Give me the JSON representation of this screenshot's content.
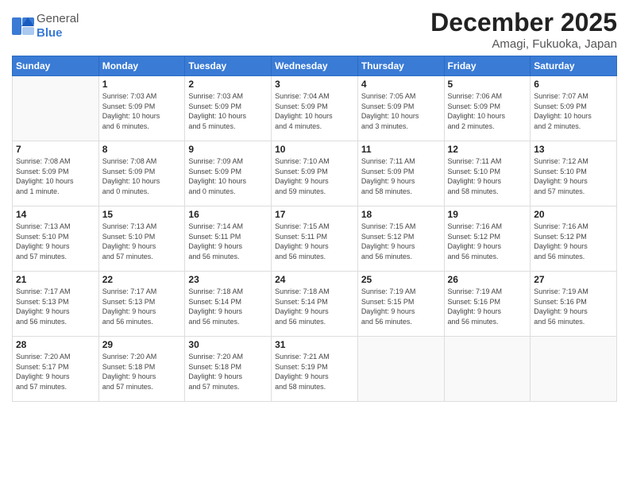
{
  "header": {
    "logo": {
      "general": "General",
      "blue": "Blue"
    },
    "title": "December 2025",
    "location": "Amagi, Fukuoka, Japan"
  },
  "weekdays": [
    "Sunday",
    "Monday",
    "Tuesday",
    "Wednesday",
    "Thursday",
    "Friday",
    "Saturday"
  ],
  "weeks": [
    [
      {
        "day": "",
        "info": ""
      },
      {
        "day": "1",
        "info": "Sunrise: 7:03 AM\nSunset: 5:09 PM\nDaylight: 10 hours\nand 6 minutes."
      },
      {
        "day": "2",
        "info": "Sunrise: 7:03 AM\nSunset: 5:09 PM\nDaylight: 10 hours\nand 5 minutes."
      },
      {
        "day": "3",
        "info": "Sunrise: 7:04 AM\nSunset: 5:09 PM\nDaylight: 10 hours\nand 4 minutes."
      },
      {
        "day": "4",
        "info": "Sunrise: 7:05 AM\nSunset: 5:09 PM\nDaylight: 10 hours\nand 3 minutes."
      },
      {
        "day": "5",
        "info": "Sunrise: 7:06 AM\nSunset: 5:09 PM\nDaylight: 10 hours\nand 2 minutes."
      },
      {
        "day": "6",
        "info": "Sunrise: 7:07 AM\nSunset: 5:09 PM\nDaylight: 10 hours\nand 2 minutes."
      }
    ],
    [
      {
        "day": "7",
        "info": "Sunrise: 7:08 AM\nSunset: 5:09 PM\nDaylight: 10 hours\nand 1 minute."
      },
      {
        "day": "8",
        "info": "Sunrise: 7:08 AM\nSunset: 5:09 PM\nDaylight: 10 hours\nand 0 minutes."
      },
      {
        "day": "9",
        "info": "Sunrise: 7:09 AM\nSunset: 5:09 PM\nDaylight: 10 hours\nand 0 minutes."
      },
      {
        "day": "10",
        "info": "Sunrise: 7:10 AM\nSunset: 5:09 PM\nDaylight: 9 hours\nand 59 minutes."
      },
      {
        "day": "11",
        "info": "Sunrise: 7:11 AM\nSunset: 5:09 PM\nDaylight: 9 hours\nand 58 minutes."
      },
      {
        "day": "12",
        "info": "Sunrise: 7:11 AM\nSunset: 5:10 PM\nDaylight: 9 hours\nand 58 minutes."
      },
      {
        "day": "13",
        "info": "Sunrise: 7:12 AM\nSunset: 5:10 PM\nDaylight: 9 hours\nand 57 minutes."
      }
    ],
    [
      {
        "day": "14",
        "info": "Sunrise: 7:13 AM\nSunset: 5:10 PM\nDaylight: 9 hours\nand 57 minutes."
      },
      {
        "day": "15",
        "info": "Sunrise: 7:13 AM\nSunset: 5:10 PM\nDaylight: 9 hours\nand 57 minutes."
      },
      {
        "day": "16",
        "info": "Sunrise: 7:14 AM\nSunset: 5:11 PM\nDaylight: 9 hours\nand 56 minutes."
      },
      {
        "day": "17",
        "info": "Sunrise: 7:15 AM\nSunset: 5:11 PM\nDaylight: 9 hours\nand 56 minutes."
      },
      {
        "day": "18",
        "info": "Sunrise: 7:15 AM\nSunset: 5:12 PM\nDaylight: 9 hours\nand 56 minutes."
      },
      {
        "day": "19",
        "info": "Sunrise: 7:16 AM\nSunset: 5:12 PM\nDaylight: 9 hours\nand 56 minutes."
      },
      {
        "day": "20",
        "info": "Sunrise: 7:16 AM\nSunset: 5:12 PM\nDaylight: 9 hours\nand 56 minutes."
      }
    ],
    [
      {
        "day": "21",
        "info": "Sunrise: 7:17 AM\nSunset: 5:13 PM\nDaylight: 9 hours\nand 56 minutes."
      },
      {
        "day": "22",
        "info": "Sunrise: 7:17 AM\nSunset: 5:13 PM\nDaylight: 9 hours\nand 56 minutes."
      },
      {
        "day": "23",
        "info": "Sunrise: 7:18 AM\nSunset: 5:14 PM\nDaylight: 9 hours\nand 56 minutes."
      },
      {
        "day": "24",
        "info": "Sunrise: 7:18 AM\nSunset: 5:14 PM\nDaylight: 9 hours\nand 56 minutes."
      },
      {
        "day": "25",
        "info": "Sunrise: 7:19 AM\nSunset: 5:15 PM\nDaylight: 9 hours\nand 56 minutes."
      },
      {
        "day": "26",
        "info": "Sunrise: 7:19 AM\nSunset: 5:16 PM\nDaylight: 9 hours\nand 56 minutes."
      },
      {
        "day": "27",
        "info": "Sunrise: 7:19 AM\nSunset: 5:16 PM\nDaylight: 9 hours\nand 56 minutes."
      }
    ],
    [
      {
        "day": "28",
        "info": "Sunrise: 7:20 AM\nSunset: 5:17 PM\nDaylight: 9 hours\nand 57 minutes."
      },
      {
        "day": "29",
        "info": "Sunrise: 7:20 AM\nSunset: 5:18 PM\nDaylight: 9 hours\nand 57 minutes."
      },
      {
        "day": "30",
        "info": "Sunrise: 7:20 AM\nSunset: 5:18 PM\nDaylight: 9 hours\nand 57 minutes."
      },
      {
        "day": "31",
        "info": "Sunrise: 7:21 AM\nSunset: 5:19 PM\nDaylight: 9 hours\nand 58 minutes."
      },
      {
        "day": "",
        "info": ""
      },
      {
        "day": "",
        "info": ""
      },
      {
        "day": "",
        "info": ""
      }
    ]
  ]
}
